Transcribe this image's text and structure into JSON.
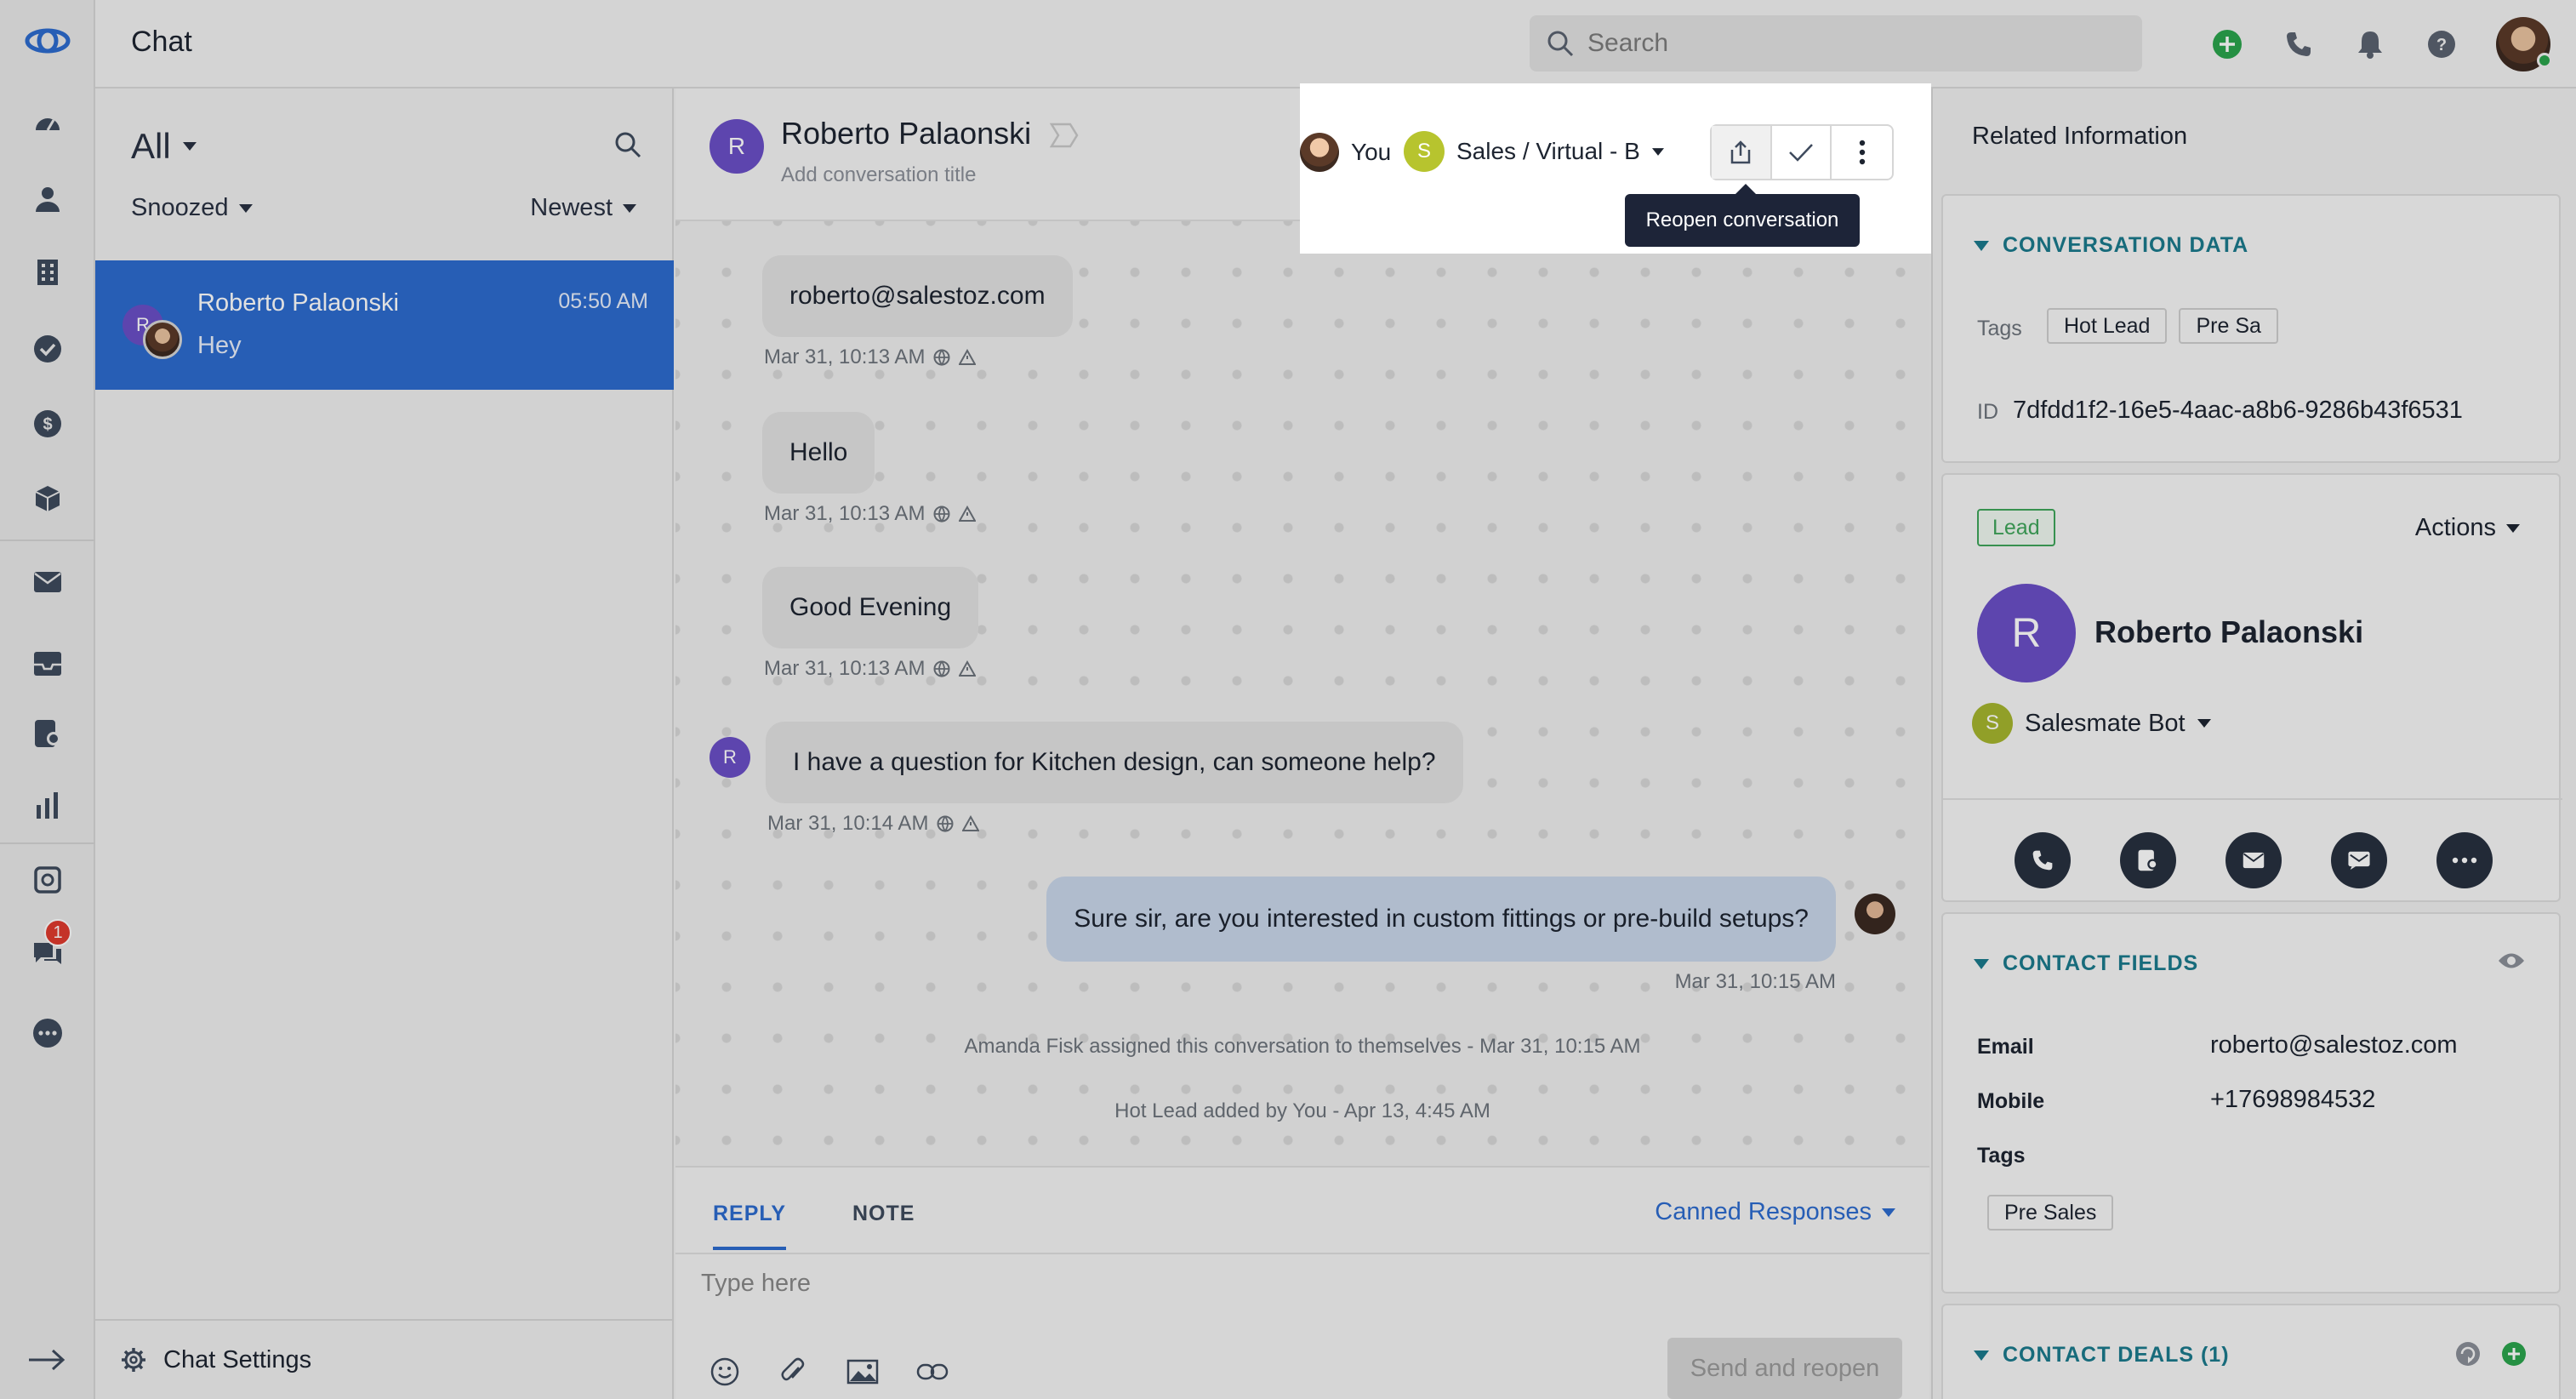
{
  "app": {
    "title": "Chat"
  },
  "search": {
    "placeholder": "Search"
  },
  "nav": {
    "items": [
      "dashboard-icon",
      "contacts-icon",
      "companies-icon",
      "tasks-icon",
      "deals-icon",
      "products-icon",
      "email-icon",
      "inbox-icon",
      "calls-icon",
      "reports-icon",
      "automation-icon",
      "chat-icon",
      "more-icon"
    ],
    "chat_badge": "1"
  },
  "list": {
    "filter": "All",
    "snoozed": "Snoozed",
    "sort": "Newest",
    "conversations": [
      {
        "name": "Roberto Palaonski",
        "time": "05:50 AM",
        "preview": "Hey",
        "initial": "R"
      }
    ],
    "settings_label": "Chat Settings"
  },
  "conversation": {
    "initial": "R",
    "name": "Roberto Palaonski",
    "title_placeholder": "Add conversation title",
    "assignee": "You",
    "team_initial": "S",
    "team": "Sales / Virtual - B",
    "tooltip": "Reopen conversation",
    "messages": [
      {
        "text": "roberto@salestoz.com",
        "meta": "Mar 31, 10:13 AM"
      },
      {
        "text": "Hello",
        "meta": "Mar 31, 10:13 AM"
      },
      {
        "text": "Good Evening",
        "meta": "Mar 31, 10:13 AM"
      },
      {
        "text": "I have a question for Kitchen design, can someone help?",
        "meta": "Mar 31, 10:14 AM"
      },
      {
        "text": "Sure sir, are you interested in custom fittings or pre-build setups?",
        "meta": "Mar 31, 10:15 AM"
      }
    ],
    "system": [
      "Amanda Fisk assigned this conversation to themselves - Mar 31, 10:15 AM",
      "Hot Lead added by You - Apr 13, 4:45 AM"
    ]
  },
  "composer": {
    "tab_reply": "REPLY",
    "tab_note": "NOTE",
    "canned": "Canned Responses",
    "placeholder": "Type here",
    "send": "Send and reopen"
  },
  "related": {
    "title": "Related Information",
    "conversation_data": {
      "heading": "CONVERSATION DATA",
      "tags_label": "Tags",
      "tags": [
        "Hot Lead",
        "Pre Sa"
      ],
      "id_label": "ID",
      "id": "7dfdd1f2-16e5-4aac-a8b6-9286b43f6531"
    },
    "contact": {
      "badge": "Lead",
      "actions": "Actions",
      "initial": "R",
      "name": "Roberto Palaonski",
      "owner_initial": "S",
      "owner": "Salesmate Bot"
    },
    "contact_fields": {
      "heading": "CONTACT FIELDS",
      "email_label": "Email",
      "email": "roberto@salestoz.com",
      "mobile_label": "Mobile",
      "mobile": "+17698984532",
      "tags_label": "Tags",
      "tags": [
        "Pre Sales"
      ]
    },
    "contact_deals": {
      "heading": "CONTACT DEALS (1)"
    }
  },
  "colors": {
    "accent": "#2d6bcf",
    "teal": "#1b7a8c",
    "lead_green": "#3fa55a",
    "avatar_purple": "#6a4fc7",
    "badge_red": "#e03b2e"
  }
}
